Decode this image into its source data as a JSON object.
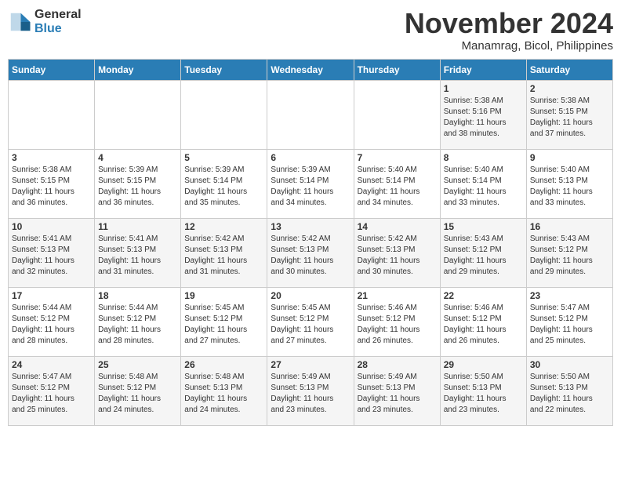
{
  "logo": {
    "general": "General",
    "blue": "Blue"
  },
  "title": "November 2024",
  "location": "Manamrag, Bicol, Philippines",
  "days_of_week": [
    "Sunday",
    "Monday",
    "Tuesday",
    "Wednesday",
    "Thursday",
    "Friday",
    "Saturday"
  ],
  "weeks": [
    [
      {
        "day": "",
        "info": ""
      },
      {
        "day": "",
        "info": ""
      },
      {
        "day": "",
        "info": ""
      },
      {
        "day": "",
        "info": ""
      },
      {
        "day": "",
        "info": ""
      },
      {
        "day": "1",
        "info": "Sunrise: 5:38 AM\nSunset: 5:16 PM\nDaylight: 11 hours\nand 38 minutes."
      },
      {
        "day": "2",
        "info": "Sunrise: 5:38 AM\nSunset: 5:15 PM\nDaylight: 11 hours\nand 37 minutes."
      }
    ],
    [
      {
        "day": "3",
        "info": "Sunrise: 5:38 AM\nSunset: 5:15 PM\nDaylight: 11 hours\nand 36 minutes."
      },
      {
        "day": "4",
        "info": "Sunrise: 5:39 AM\nSunset: 5:15 PM\nDaylight: 11 hours\nand 36 minutes."
      },
      {
        "day": "5",
        "info": "Sunrise: 5:39 AM\nSunset: 5:14 PM\nDaylight: 11 hours\nand 35 minutes."
      },
      {
        "day": "6",
        "info": "Sunrise: 5:39 AM\nSunset: 5:14 PM\nDaylight: 11 hours\nand 34 minutes."
      },
      {
        "day": "7",
        "info": "Sunrise: 5:40 AM\nSunset: 5:14 PM\nDaylight: 11 hours\nand 34 minutes."
      },
      {
        "day": "8",
        "info": "Sunrise: 5:40 AM\nSunset: 5:14 PM\nDaylight: 11 hours\nand 33 minutes."
      },
      {
        "day": "9",
        "info": "Sunrise: 5:40 AM\nSunset: 5:13 PM\nDaylight: 11 hours\nand 33 minutes."
      }
    ],
    [
      {
        "day": "10",
        "info": "Sunrise: 5:41 AM\nSunset: 5:13 PM\nDaylight: 11 hours\nand 32 minutes."
      },
      {
        "day": "11",
        "info": "Sunrise: 5:41 AM\nSunset: 5:13 PM\nDaylight: 11 hours\nand 31 minutes."
      },
      {
        "day": "12",
        "info": "Sunrise: 5:42 AM\nSunset: 5:13 PM\nDaylight: 11 hours\nand 31 minutes."
      },
      {
        "day": "13",
        "info": "Sunrise: 5:42 AM\nSunset: 5:13 PM\nDaylight: 11 hours\nand 30 minutes."
      },
      {
        "day": "14",
        "info": "Sunrise: 5:42 AM\nSunset: 5:13 PM\nDaylight: 11 hours\nand 30 minutes."
      },
      {
        "day": "15",
        "info": "Sunrise: 5:43 AM\nSunset: 5:12 PM\nDaylight: 11 hours\nand 29 minutes."
      },
      {
        "day": "16",
        "info": "Sunrise: 5:43 AM\nSunset: 5:12 PM\nDaylight: 11 hours\nand 29 minutes."
      }
    ],
    [
      {
        "day": "17",
        "info": "Sunrise: 5:44 AM\nSunset: 5:12 PM\nDaylight: 11 hours\nand 28 minutes."
      },
      {
        "day": "18",
        "info": "Sunrise: 5:44 AM\nSunset: 5:12 PM\nDaylight: 11 hours\nand 28 minutes."
      },
      {
        "day": "19",
        "info": "Sunrise: 5:45 AM\nSunset: 5:12 PM\nDaylight: 11 hours\nand 27 minutes."
      },
      {
        "day": "20",
        "info": "Sunrise: 5:45 AM\nSunset: 5:12 PM\nDaylight: 11 hours\nand 27 minutes."
      },
      {
        "day": "21",
        "info": "Sunrise: 5:46 AM\nSunset: 5:12 PM\nDaylight: 11 hours\nand 26 minutes."
      },
      {
        "day": "22",
        "info": "Sunrise: 5:46 AM\nSunset: 5:12 PM\nDaylight: 11 hours\nand 26 minutes."
      },
      {
        "day": "23",
        "info": "Sunrise: 5:47 AM\nSunset: 5:12 PM\nDaylight: 11 hours\nand 25 minutes."
      }
    ],
    [
      {
        "day": "24",
        "info": "Sunrise: 5:47 AM\nSunset: 5:12 PM\nDaylight: 11 hours\nand 25 minutes."
      },
      {
        "day": "25",
        "info": "Sunrise: 5:48 AM\nSunset: 5:12 PM\nDaylight: 11 hours\nand 24 minutes."
      },
      {
        "day": "26",
        "info": "Sunrise: 5:48 AM\nSunset: 5:13 PM\nDaylight: 11 hours\nand 24 minutes."
      },
      {
        "day": "27",
        "info": "Sunrise: 5:49 AM\nSunset: 5:13 PM\nDaylight: 11 hours\nand 23 minutes."
      },
      {
        "day": "28",
        "info": "Sunrise: 5:49 AM\nSunset: 5:13 PM\nDaylight: 11 hours\nand 23 minutes."
      },
      {
        "day": "29",
        "info": "Sunrise: 5:50 AM\nSunset: 5:13 PM\nDaylight: 11 hours\nand 23 minutes."
      },
      {
        "day": "30",
        "info": "Sunrise: 5:50 AM\nSunset: 5:13 PM\nDaylight: 11 hours\nand 22 minutes."
      }
    ]
  ]
}
